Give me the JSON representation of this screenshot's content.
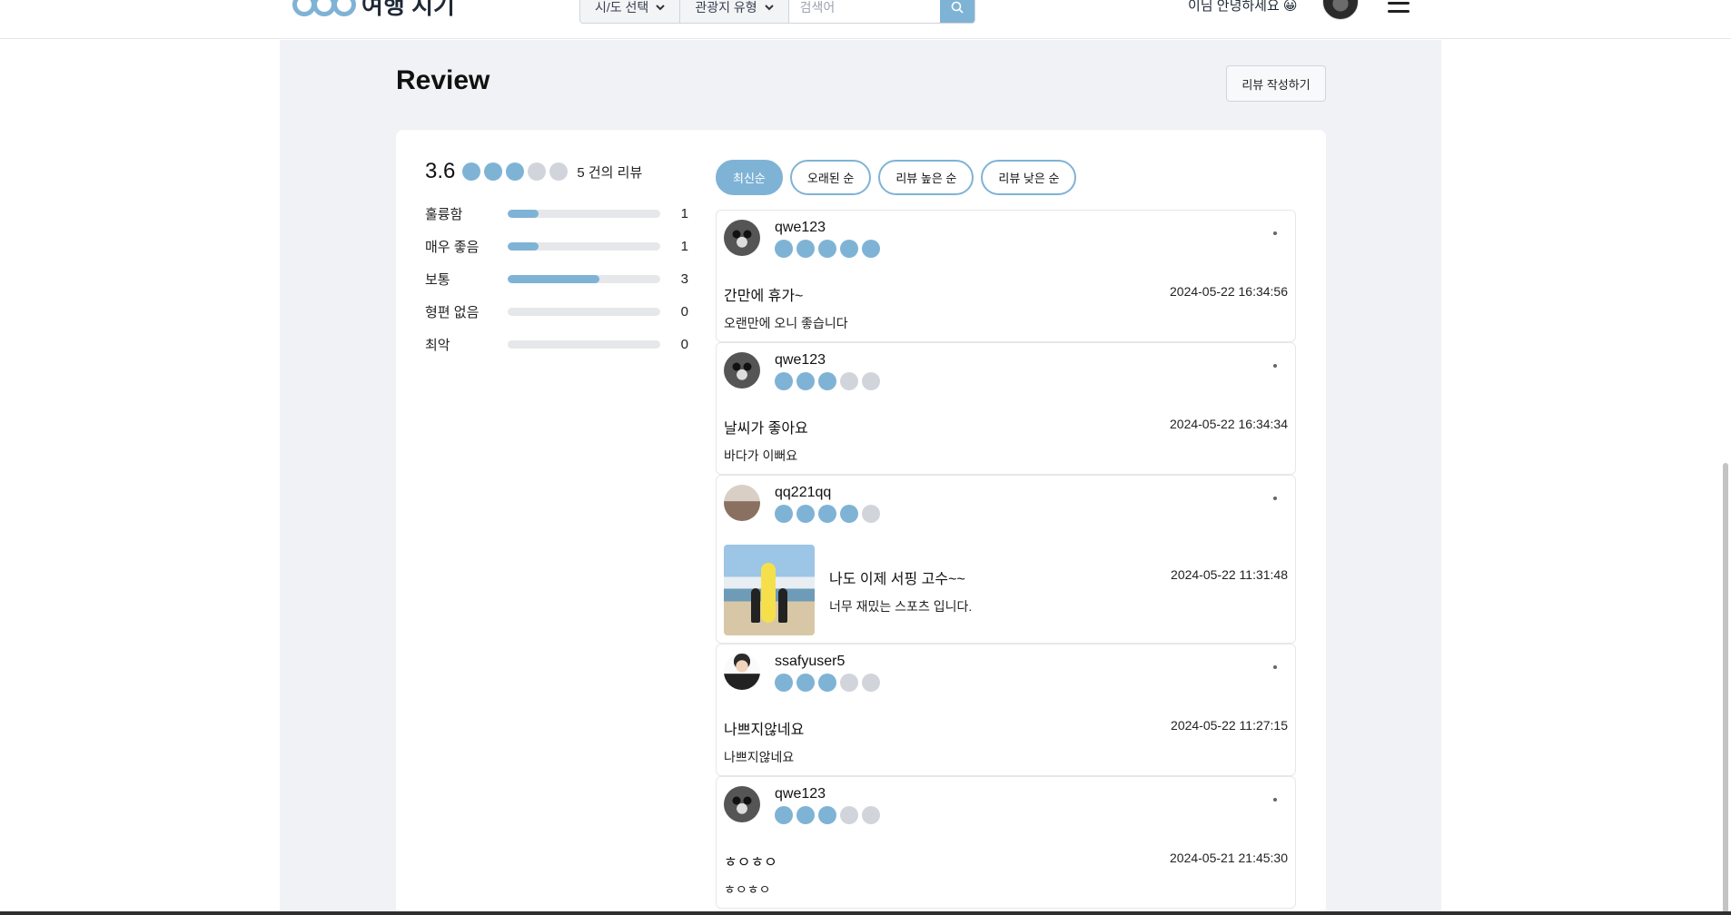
{
  "header": {
    "logo_text": "여행 지기",
    "region_select": "시/도 선택",
    "type_select": "관광지 유형",
    "search_placeholder": "검색어",
    "greeting": "이님 안녕하세요 😀"
  },
  "page": {
    "title": "Review",
    "write_button": "리뷰 작성하기"
  },
  "summary": {
    "average": "3.6",
    "average_value": 3.6,
    "max_rating": 5,
    "review_count": "5 건의 리뷰",
    "distribution": [
      {
        "label": "훌륭함",
        "count": "1",
        "share": 0.2
      },
      {
        "label": "매우 좋음",
        "count": "1",
        "share": 0.2
      },
      {
        "label": "보통",
        "count": "3",
        "share": 0.6
      },
      {
        "label": "형편 없음",
        "count": "0",
        "share": 0
      },
      {
        "label": "최악",
        "count": "0",
        "share": 0
      }
    ]
  },
  "sort_options": [
    "최신순",
    "오래된 순",
    "리뷰 높은 순",
    "리뷰 낮은 순"
  ],
  "active_sort": "최신순",
  "reviews": [
    {
      "user": "qwe123",
      "rating": 5,
      "title": "간만에 휴가~",
      "date": "2024-05-22 16:34:56",
      "body": "오랜만에 오니 좋습니다"
    },
    {
      "user": "qwe123",
      "rating": 3,
      "title": "날씨가 좋아요",
      "date": "2024-05-22 16:34:34",
      "body": "바다가 이뻐요"
    },
    {
      "user": "qq221qq",
      "rating": 4,
      "title": "나도 이제 서핑 고수~~",
      "date": "2024-05-22 11:31:48",
      "body": "너무 재밌는 스포츠 입니다."
    },
    {
      "user": "ssafyuser5",
      "rating": 3,
      "title": "나쁘지않네요",
      "date": "2024-05-22 11:27:15",
      "body": "나쁘지않네요"
    },
    {
      "user": "qwe123",
      "rating": 3,
      "title": "ㅎㅇㅎㅇ",
      "date": "2024-05-21 21:45:30",
      "body": "ㅎㅇㅎㅇ"
    }
  ],
  "colors": {
    "accent": "#7fb3d5",
    "inactive_dot": "#d1d5db",
    "page_background": "#f0f2f5"
  }
}
